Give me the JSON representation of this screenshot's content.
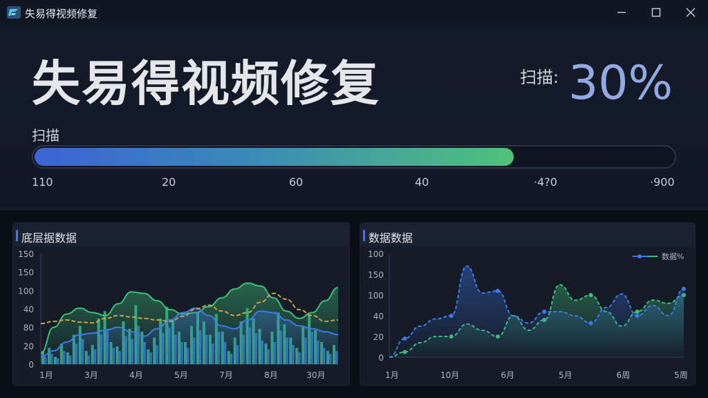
{
  "window": {
    "title": "失易得视频修复",
    "controls": {
      "minimize": "minimize-icon",
      "maximize": "maximize-icon",
      "close": "close-icon"
    }
  },
  "hero": {
    "title": "失易得视频修复",
    "scan_prefix": "扫描:",
    "scan_percent": "30%",
    "bar_label": "扫描",
    "progress_fraction": 0.75,
    "ticks": [
      "110",
      "20",
      "60",
      "40",
      "·4?0",
      "·900"
    ]
  },
  "colors": {
    "accent": "#93a9e2",
    "bar_start": "#3c63d6",
    "bar_end": "#50c27a",
    "green": "#3fbf78",
    "blue": "#3d7bea",
    "gold": "#c9a44a"
  },
  "panels": {
    "left": {
      "title": "底层据数据"
    },
    "right": {
      "title": "数据数据"
    }
  },
  "chart_data": [
    {
      "type": "bar",
      "ylim": [
        0,
        150
      ],
      "y_ticks": [
        "150",
        "150",
        "100",
        "40",
        "80",
        "20",
        "0"
      ],
      "x_ticks": [
        "1月",
        "3月",
        "4月",
        "5月",
        "7月",
        "8月",
        "30月"
      ],
      "bars_green": [
        18,
        22,
        10,
        28,
        16,
        40,
        52,
        18,
        26,
        62,
        72,
        30,
        24,
        58,
        48,
        80,
        44,
        20,
        36,
        62,
        78,
        60,
        44,
        30,
        52,
        70,
        58,
        40,
        68,
        44,
        18,
        36,
        58,
        76,
        62,
        48,
        28,
        44,
        70,
        54,
        36,
        22,
        52,
        66,
        46,
        30,
        18,
        26
      ],
      "bars_blue": [
        10,
        14,
        8,
        18,
        12,
        28,
        34,
        12,
        20,
        40,
        48,
        22,
        18,
        38,
        34,
        52,
        30,
        16,
        26,
        42,
        50,
        40,
        30,
        22,
        36,
        46,
        40,
        28,
        44,
        30,
        14,
        26,
        40,
        50,
        42,
        32,
        20,
        30,
        46,
        36,
        26,
        16,
        36,
        44,
        32,
        22,
        14,
        18
      ],
      "line_gold": [
        55,
        58,
        60,
        57,
        56,
        62,
        66,
        64,
        62,
        60,
        58,
        65,
        75,
        80,
        72,
        66,
        70,
        84,
        96,
        88,
        74,
        66,
        58,
        60
      ],
      "line_green": [
        15,
        50,
        68,
        76,
        70,
        66,
        82,
        98,
        96,
        86,
        74,
        68,
        70,
        78,
        90,
        102,
        110,
        106,
        90,
        72,
        62,
        70,
        86,
        104
      ],
      "line_blue": [
        10,
        18,
        30,
        40,
        42,
        46,
        50,
        44,
        38,
        48,
        60,
        70,
        76,
        66,
        52,
        48,
        60,
        72,
        70,
        60,
        52,
        48,
        44,
        40
      ]
    },
    {
      "type": "line",
      "ylim": [
        0,
        100
      ],
      "y_ticks": [
        "100",
        "150",
        "100",
        "40",
        "20",
        "0"
      ],
      "x_ticks": [
        "1月",
        "10月",
        "6月",
        "5月",
        "6周",
        "5周"
      ],
      "legend": "数据%",
      "series_blue": [
        0,
        18,
        30,
        37,
        40,
        88,
        62,
        64,
        40,
        33,
        44,
        44,
        40,
        33,
        48,
        61,
        40,
        50,
        40,
        66
      ],
      "series_green": [
        0,
        5,
        14,
        20,
        20,
        32,
        26,
        20,
        40,
        26,
        36,
        70,
        55,
        60,
        44,
        30,
        44,
        55,
        52,
        60
      ]
    }
  ]
}
